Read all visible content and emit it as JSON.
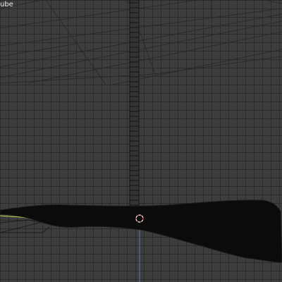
{
  "viewport": {
    "object_label": "ube",
    "background_color": "#3d3d3d",
    "grid_color": "#2b2b2b",
    "wire_color": "#2a2a2a",
    "mesh_fill_color": "#0b0b0b",
    "axis_z_color": "#5b7cb8",
    "cursor_color": "#e05252",
    "edge_highlight_color": "#c8d050"
  },
  "icons": {
    "cursor": "3d-cursor-icon"
  }
}
